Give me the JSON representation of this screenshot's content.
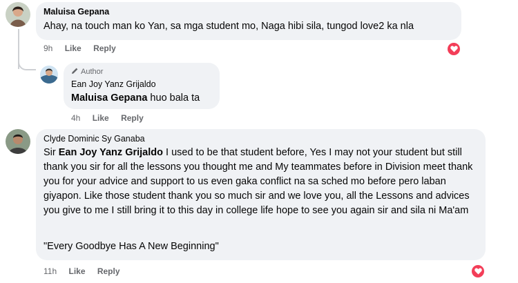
{
  "comments": [
    {
      "author": "Maluisa Gepana",
      "text": "Ahay, na touch man ko Yan, sa mga student mo, Naga hibi sila, tungod love2 ka nla",
      "time": "9h",
      "like_label": "Like",
      "reply_label": "Reply",
      "reaction": "love"
    },
    {
      "badge": "Author",
      "author": "Ean Joy Yanz Grijaldo",
      "mention": "Maluisa Gepana",
      "text": " huo bala ta",
      "time": "4h",
      "like_label": "Like",
      "reply_label": "Reply"
    },
    {
      "author": "Clyde Dominic Sy Ganaba",
      "prefix": "Sir ",
      "mention": "Ean Joy Yanz Grijaldo",
      "text": " I used to be that student before, Yes I may not your student but still thank you sir for all the lessons you thought me and My teammates before in Division meet thank you for your advice and support to us even gaka conflict na sa sched mo before pero laban giyapon. Like those student thank you so much sir and we love you, all the Lessons and advices you give to me I still bring it to this day in college life hope to see you again sir and sila ni Ma'am",
      "quote": "\"Every Goodbye Has A New Beginning\"",
      "time": "11h",
      "like_label": "Like",
      "reply_label": "Reply",
      "reaction": "love"
    }
  ],
  "colors": {
    "bubble": "#f0f2f5",
    "meta": "#65676b",
    "love": "#f33e58"
  },
  "icons": {
    "badge": "pencil-icon",
    "reaction": "heart-icon"
  }
}
